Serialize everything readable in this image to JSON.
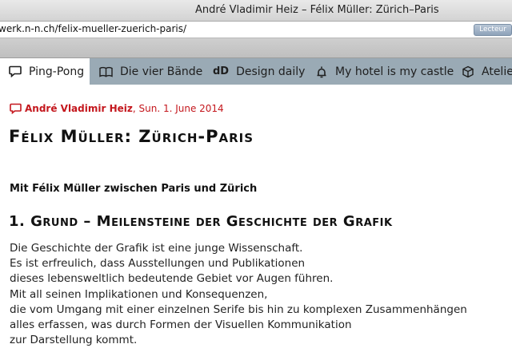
{
  "window": {
    "title": "André Vladimir Heiz – Félix Müller: Zürich–Paris",
    "url": "werk.n-n.ch/felix-mueller-zuerich-paris/",
    "reader_label": "Lecteur"
  },
  "nav": {
    "items": [
      {
        "label": "Ping-Pong",
        "icon": "speech-bubble-icon"
      },
      {
        "label": "Die vier Bände",
        "icon": "open-book-icon"
      },
      {
        "label": "Design daily",
        "icon": "dd-logo-icon",
        "mark": "dD"
      },
      {
        "label": "My hotel is my castle",
        "icon": "bell-icon"
      },
      {
        "label": "Atelie",
        "icon": "cube-icon"
      }
    ]
  },
  "post": {
    "author": "André Vladimir Heiz",
    "date": ", Sun. 1. June 2014",
    "title": "Félix Müller: Zürich-Paris",
    "subtitle": "Mit Félix Müller zwischen Paris und Zürich",
    "section_heading": "1. Grund – Meilensteine der Geschichte der Grafik",
    "lines": [
      "Die Geschichte der Grafik ist eine junge Wissenschaft.",
      "Es ist erfreulich, dass Ausstellungen und Publikationen",
      "dieses lebensweltlich bedeutende Gebiet vor Augen führen.",
      "Mit all seinen Implikationen und Konsequenzen,",
      "die vom Umgang mit einer einzelnen Serife bis hin zu komplexen Zusammenhängen",
      "alles erfassen, was durch Formen der Visuellen Kommunikation",
      "zur Darstellung kommt."
    ]
  },
  "colors": {
    "accent": "#c4171d",
    "nav_background": "#9aaab5",
    "active_tab": "#ffffff"
  }
}
